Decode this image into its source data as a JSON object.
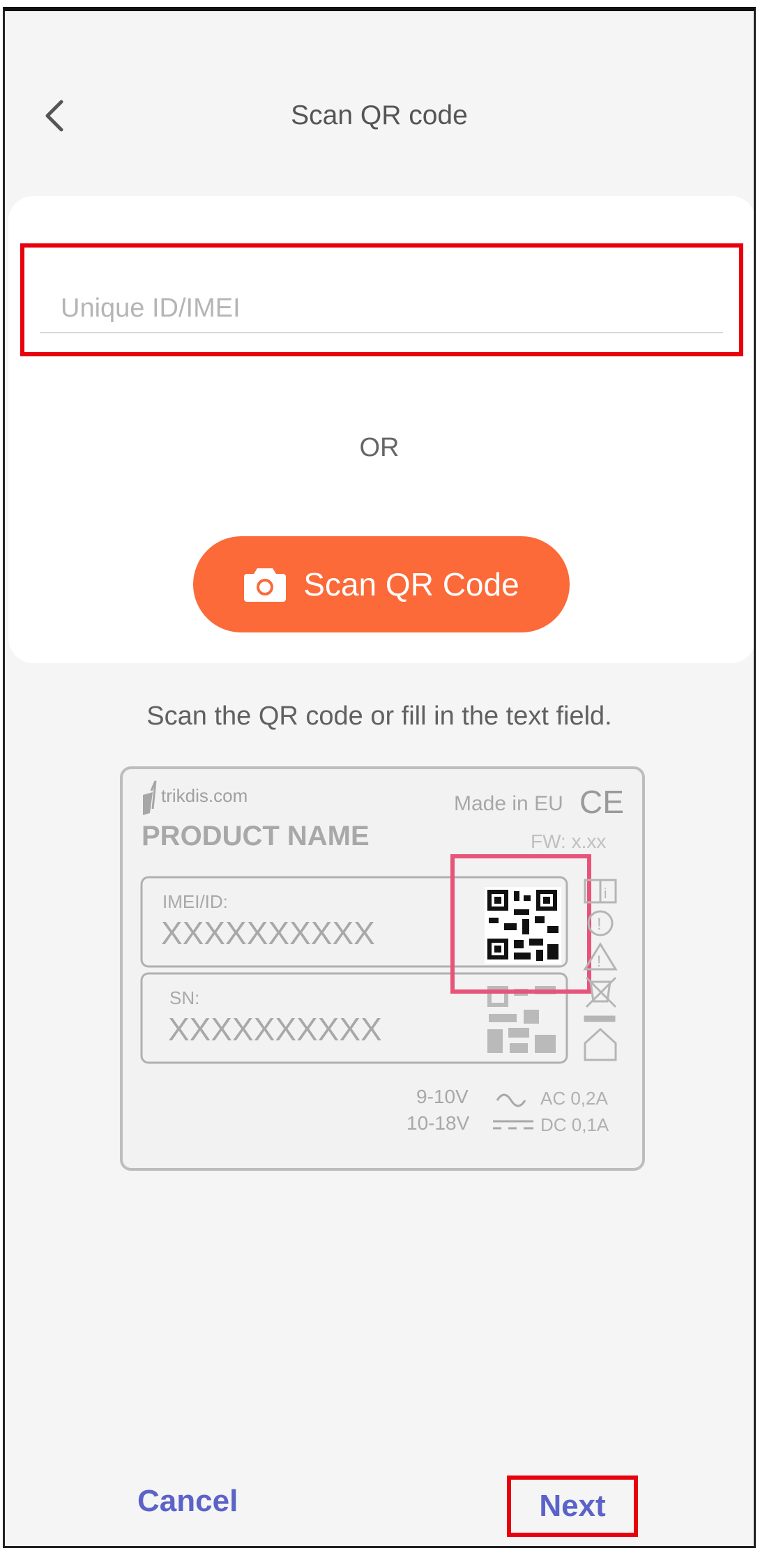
{
  "header": {
    "title": "Scan QR code",
    "back_icon": "chevron-left-icon"
  },
  "form": {
    "id_placeholder": "Unique ID/IMEI",
    "id_value": "",
    "or_text": "OR",
    "scan_button_label": "Scan QR Code",
    "scan_button_icon": "camera-icon",
    "hint": "Scan the QR code or fill in the text field."
  },
  "product_label": {
    "brand": "trikdis.com",
    "made_in": "Made in EU",
    "ce_mark": "CE",
    "product_name": "PRODUCT NAME",
    "fw": "FW: x.xx",
    "imei_label": "IMEI/ID:",
    "imei_value": "XXXXXXXXXX",
    "sn_label": "SN:",
    "sn_value": "XXXXXXXXXX",
    "voltage_ac": "9-10V",
    "voltage_dc": "10-18V",
    "current_ac": "AC 0,2A",
    "current_dc": "DC 0,1A"
  },
  "footer": {
    "cancel_label": "Cancel",
    "next_label": "Next"
  },
  "colors": {
    "accent": "#fb6a38",
    "link": "#5b63c9",
    "highlight": "#e8000d",
    "qr_highlight": "#e8537a"
  }
}
